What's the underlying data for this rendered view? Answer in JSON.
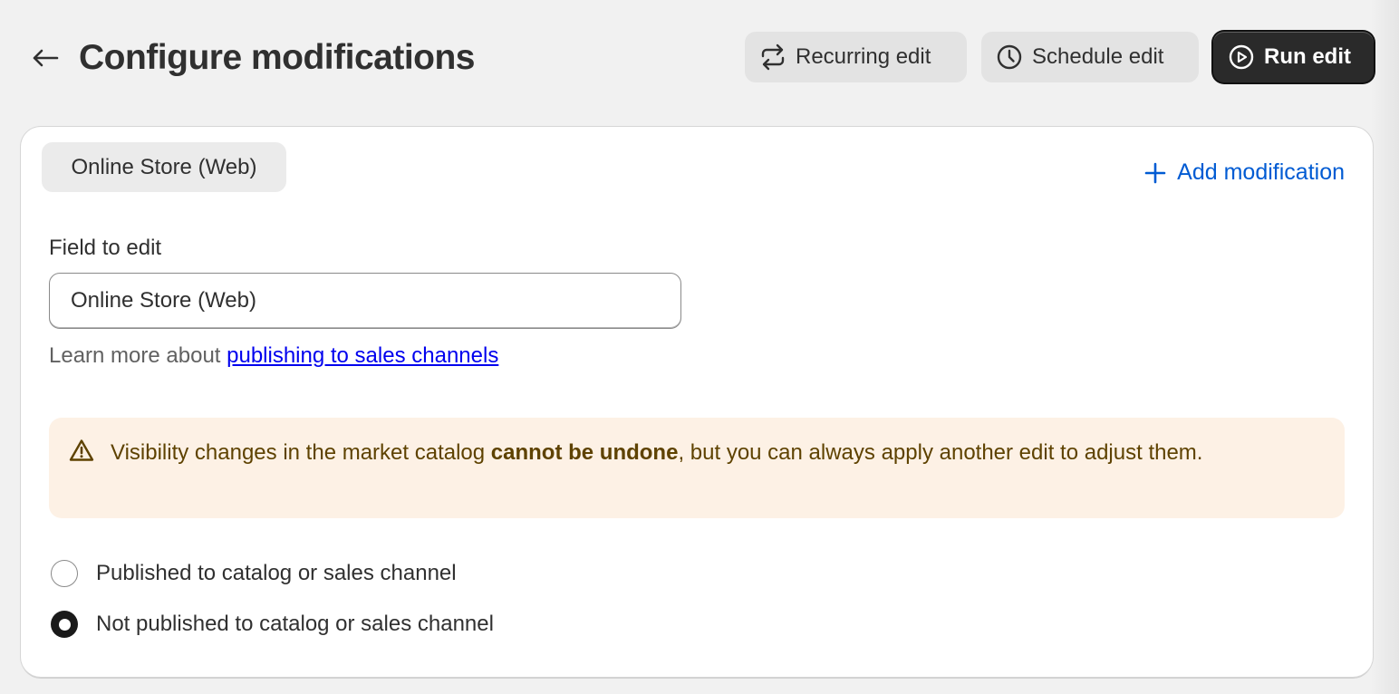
{
  "header": {
    "title": "Configure modifications",
    "back_icon": "arrow-left-icon",
    "buttons": {
      "recurring": {
        "label": "Recurring edit",
        "icon": "repeat-icon"
      },
      "schedule": {
        "label": "Schedule edit",
        "icon": "clock-icon"
      },
      "run": {
        "label": "Run edit",
        "icon": "play-circle-icon"
      }
    }
  },
  "card": {
    "channel_tab": "Online Store (Web)",
    "add_modification": {
      "label": "Add modification",
      "icon": "plus-icon"
    },
    "field": {
      "label": "Field to edit",
      "value": "Online Store (Web)"
    },
    "help": {
      "prefix": "Learn more about ",
      "link": "publishing to sales channels"
    },
    "warning": {
      "icon": "alert-triangle-icon",
      "text_before": "Visibility changes in the market catalog ",
      "text_bold": "cannot be undone",
      "text_after": ", but you can always apply another edit to adjust them."
    },
    "options": [
      {
        "label": "Published to catalog or sales channel",
        "selected": false
      },
      {
        "label": "Not published to catalog or sales channel",
        "selected": true
      }
    ]
  },
  "colors": {
    "primary_button": "#2a2a2a",
    "link_blue": "#005bd3",
    "warning_bg": "#fdf1e5",
    "warning_text": "#5e4200"
  }
}
